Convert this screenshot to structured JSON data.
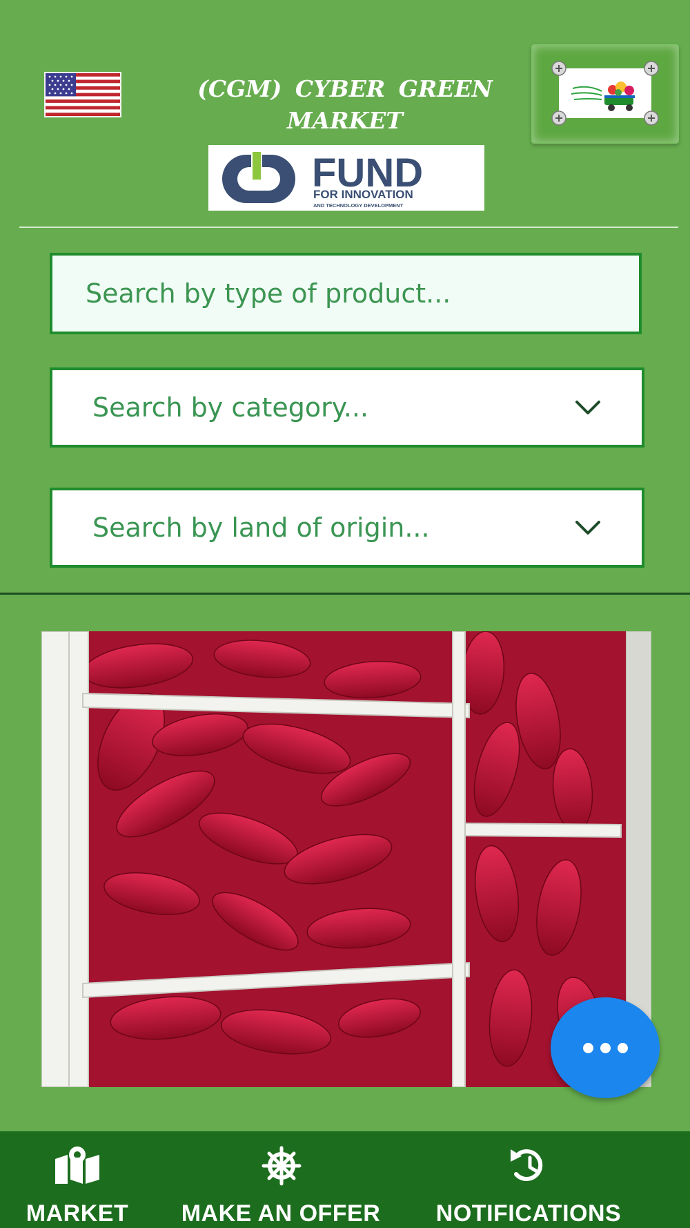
{
  "header": {
    "title_line1": "(CGM)  CYBER GREEN",
    "title_line2": "MARKET",
    "fund_logo": {
      "word": "FUND",
      "subline1": "FOR INNOVATION",
      "subline2": "AND TECHNOLOGY DEVELOPMENT"
    },
    "language_flag": "us-flag-icon",
    "app_logo": "cyber-green-market-logo"
  },
  "search": {
    "product_placeholder": "Search by type of product...",
    "category_placeholder": "Search by category...",
    "origin_placeholder": "Search by land of origin..."
  },
  "bottom_nav": {
    "items": [
      {
        "label": "MARKET",
        "icon": "map-icon"
      },
      {
        "label": "MAKE AN OFFER",
        "icon": "ship-wheel-icon"
      },
      {
        "label": "NOTIFICATIONS",
        "icon": "history-icon"
      }
    ]
  },
  "colors": {
    "background": "#67ad4f",
    "nav_bar": "#1c6d1e",
    "input_border": "#1f8c2d",
    "placeholder_text": "#3a9553",
    "fab": "#1b86ee"
  }
}
